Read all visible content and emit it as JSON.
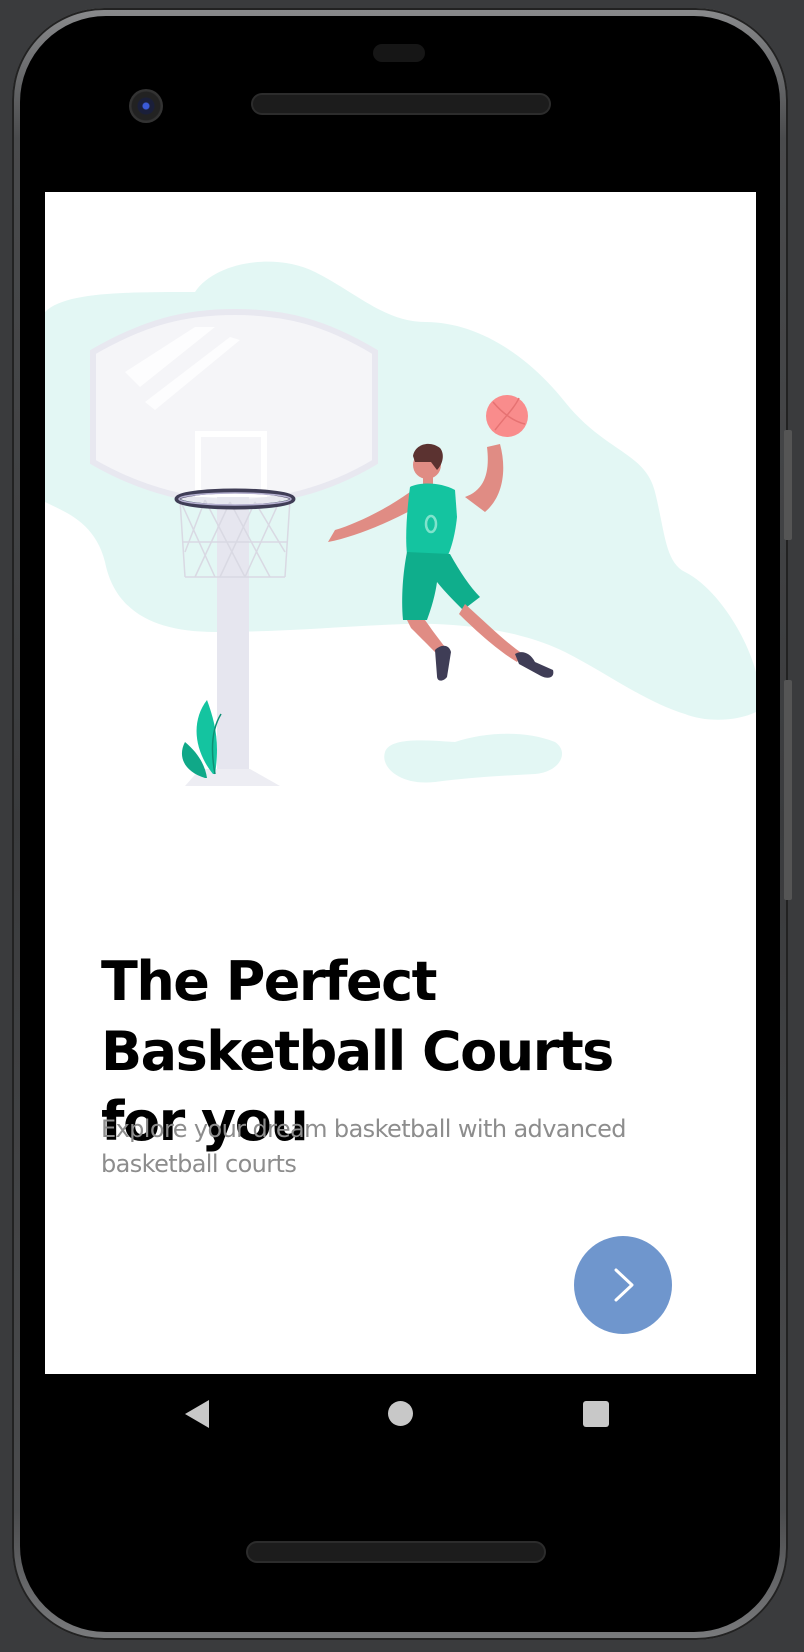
{
  "onboarding": {
    "title": "The Perfect Basketball Courts for you",
    "subtitle": "Explore your dream basketball with advanced basketball courts"
  },
  "icons": {
    "next": "chevron-right-icon",
    "back": "back-triangle-icon",
    "home": "home-circle-icon",
    "recents": "recents-square-icon"
  },
  "colors": {
    "accent": "#6f96cd",
    "title": "#000000",
    "subtitle": "#8d8d8d",
    "blob": "#e3f7f4",
    "jersey": "#14c4a0",
    "ball": "#f98c8c",
    "skin": "#e08c84"
  }
}
